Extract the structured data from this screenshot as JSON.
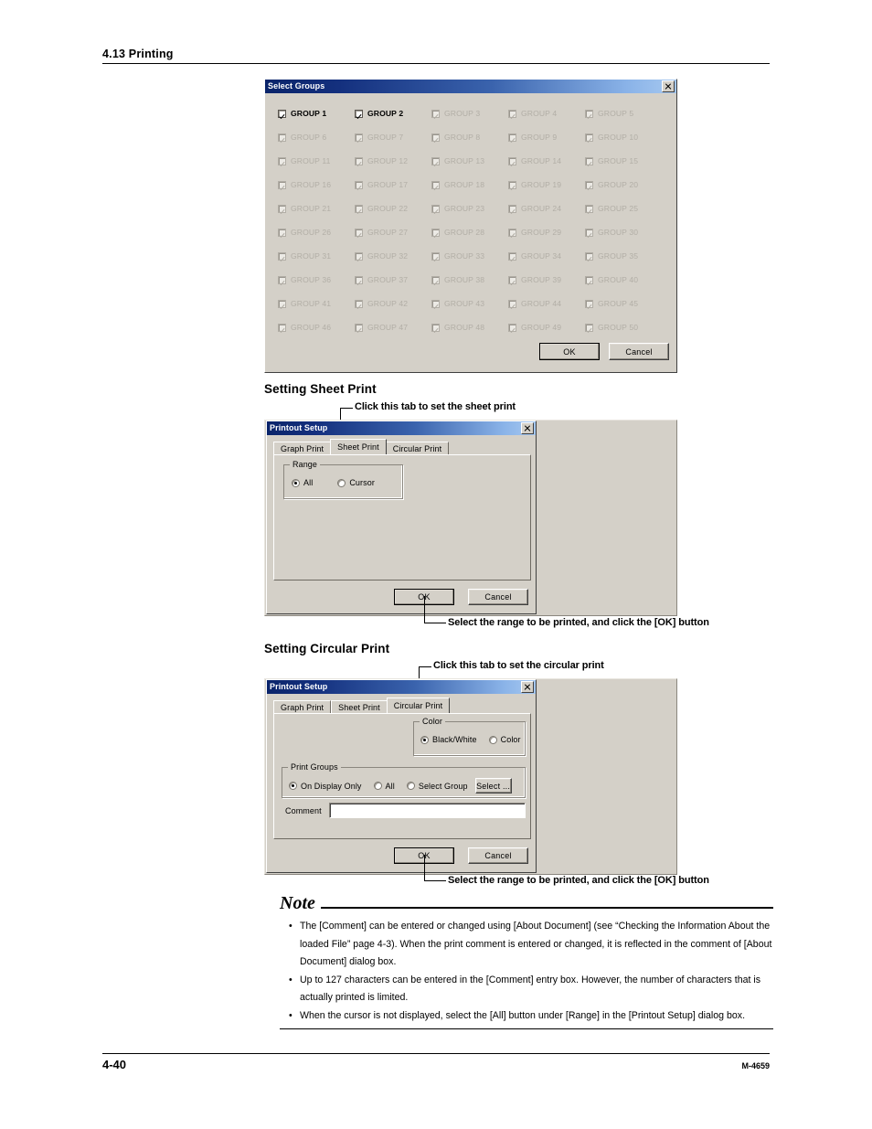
{
  "header": {
    "title": "4.13  Printing"
  },
  "footer": {
    "page_number": "4-40",
    "doc_code": "M-4659"
  },
  "select_groups_dialog": {
    "title": "Select Groups",
    "close_icon": "close-icon",
    "groups": [
      {
        "label": "GROUP 1",
        "enabled": true,
        "checked": true
      },
      {
        "label": "GROUP 2",
        "enabled": true,
        "checked": true
      },
      {
        "label": "GROUP 3",
        "enabled": false,
        "checked": true
      },
      {
        "label": "GROUP 4",
        "enabled": false,
        "checked": true
      },
      {
        "label": "GROUP 5",
        "enabled": false,
        "checked": true
      },
      {
        "label": "GROUP 6",
        "enabled": false,
        "checked": true
      },
      {
        "label": "GROUP 7",
        "enabled": false,
        "checked": true
      },
      {
        "label": "GROUP 8",
        "enabled": false,
        "checked": true
      },
      {
        "label": "GROUP 9",
        "enabled": false,
        "checked": true
      },
      {
        "label": "GROUP 10",
        "enabled": false,
        "checked": true
      },
      {
        "label": "GROUP 11",
        "enabled": false,
        "checked": true
      },
      {
        "label": "GROUP 12",
        "enabled": false,
        "checked": true
      },
      {
        "label": "GROUP 13",
        "enabled": false,
        "checked": true
      },
      {
        "label": "GROUP 14",
        "enabled": false,
        "checked": true
      },
      {
        "label": "GROUP 15",
        "enabled": false,
        "checked": true
      },
      {
        "label": "GROUP 16",
        "enabled": false,
        "checked": true
      },
      {
        "label": "GROUP 17",
        "enabled": false,
        "checked": true
      },
      {
        "label": "GROUP 18",
        "enabled": false,
        "checked": true
      },
      {
        "label": "GROUP 19",
        "enabled": false,
        "checked": true
      },
      {
        "label": "GROUP 20",
        "enabled": false,
        "checked": true
      },
      {
        "label": "GROUP 21",
        "enabled": false,
        "checked": true
      },
      {
        "label": "GROUP 22",
        "enabled": false,
        "checked": true
      },
      {
        "label": "GROUP 23",
        "enabled": false,
        "checked": true
      },
      {
        "label": "GROUP 24",
        "enabled": false,
        "checked": true
      },
      {
        "label": "GROUP 25",
        "enabled": false,
        "checked": true
      },
      {
        "label": "GROUP 26",
        "enabled": false,
        "checked": true
      },
      {
        "label": "GROUP 27",
        "enabled": false,
        "checked": true
      },
      {
        "label": "GROUP 28",
        "enabled": false,
        "checked": true
      },
      {
        "label": "GROUP 29",
        "enabled": false,
        "checked": true
      },
      {
        "label": "GROUP 30",
        "enabled": false,
        "checked": true
      },
      {
        "label": "GROUP 31",
        "enabled": false,
        "checked": true
      },
      {
        "label": "GROUP 32",
        "enabled": false,
        "checked": true
      },
      {
        "label": "GROUP 33",
        "enabled": false,
        "checked": true
      },
      {
        "label": "GROUP 34",
        "enabled": false,
        "checked": true
      },
      {
        "label": "GROUP 35",
        "enabled": false,
        "checked": true
      },
      {
        "label": "GROUP 36",
        "enabled": false,
        "checked": true
      },
      {
        "label": "GROUP 37",
        "enabled": false,
        "checked": true
      },
      {
        "label": "GROUP 38",
        "enabled": false,
        "checked": true
      },
      {
        "label": "GROUP 39",
        "enabled": false,
        "checked": true
      },
      {
        "label": "GROUP 40",
        "enabled": false,
        "checked": true
      },
      {
        "label": "GROUP 41",
        "enabled": false,
        "checked": true
      },
      {
        "label": "GROUP 42",
        "enabled": false,
        "checked": true
      },
      {
        "label": "GROUP 43",
        "enabled": false,
        "checked": true
      },
      {
        "label": "GROUP 44",
        "enabled": false,
        "checked": true
      },
      {
        "label": "GROUP 45",
        "enabled": false,
        "checked": true
      },
      {
        "label": "GROUP 46",
        "enabled": false,
        "checked": true
      },
      {
        "label": "GROUP 47",
        "enabled": false,
        "checked": true
      },
      {
        "label": "GROUP 48",
        "enabled": false,
        "checked": true
      },
      {
        "label": "GROUP 49",
        "enabled": false,
        "checked": true
      },
      {
        "label": "GROUP 50",
        "enabled": false,
        "checked": true
      }
    ],
    "ok_label": "OK",
    "cancel_label": "Cancel"
  },
  "sheet_print": {
    "heading": "Setting Sheet Print",
    "callout_tab": "Click this tab to set the sheet print",
    "callout_ok": "Select the range to be printed, and click the [OK] button",
    "dialog": {
      "title": "Printout Setup",
      "close_icon": "close-icon",
      "tabs": [
        {
          "label": "Graph Print",
          "active": false
        },
        {
          "label": "Sheet Print",
          "active": true
        },
        {
          "label": "Circular Print",
          "active": false
        }
      ],
      "range_group": {
        "label": "Range",
        "options": [
          {
            "label": "All",
            "selected": true
          },
          {
            "label": "Cursor",
            "selected": false
          }
        ]
      },
      "ok_label": "OK",
      "cancel_label": "Cancel"
    }
  },
  "circular_print": {
    "heading": "Setting Circular Print",
    "callout_tab": "Click this tab to set the circular print",
    "callout_ok": "Select the range to be printed, and click the [OK] button",
    "dialog": {
      "title": "Printout Setup",
      "close_icon": "close-icon",
      "tabs": [
        {
          "label": "Graph Print",
          "active": false
        },
        {
          "label": "Sheet Print",
          "active": false
        },
        {
          "label": "Circular Print",
          "active": true
        }
      ],
      "color_group": {
        "label": "Color",
        "options": [
          {
            "label": "Black/White",
            "selected": true
          },
          {
            "label": "Color",
            "selected": false
          }
        ]
      },
      "print_groups": {
        "label": "Print Groups",
        "options": [
          {
            "label": "On Display Only",
            "selected": true
          },
          {
            "label": "All",
            "selected": false
          },
          {
            "label": "Select Group",
            "selected": false
          }
        ],
        "select_button": "Select ..."
      },
      "comment_label": "Comment",
      "comment_value": "",
      "ok_label": "OK",
      "cancel_label": "Cancel"
    }
  },
  "note": {
    "heading": "Note",
    "items": [
      "The [Comment] can be entered or changed using [About Document] (see “Checking the Information About the loaded File” page 4-3).  When the print comment is entered or changed, it is reflected in the comment of [About Document] dialog box.",
      "Up to 127 characters can be entered in the [Comment] entry box.  However, the number of characters that is actually printed is limited.",
      "When the cursor is not displayed, select the [All] button under [Range] in the [Printout Setup] dialog box."
    ],
    "bullet": "•"
  }
}
